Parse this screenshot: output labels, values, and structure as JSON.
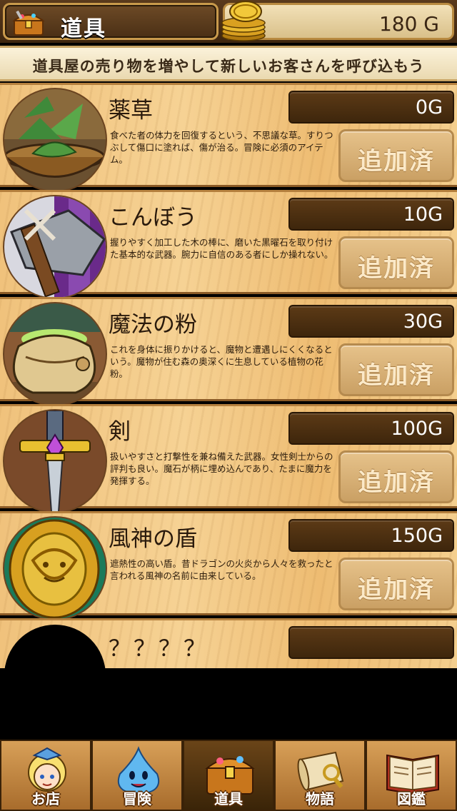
{
  "header": {
    "title": "道具",
    "title_icon": "treasure-chest-icon",
    "gold": "180 G",
    "gold_icon": "gold-coins-icon"
  },
  "banner": {
    "text": "道具屋の売り物を増やして新しいお客さんを呼び込もう"
  },
  "items": [
    {
      "name": "薬草",
      "price": "0G",
      "description": "食べた者の体力を回復するという、不思議な草。すりつぶして傷口に塗れば、傷が治る。冒険に必須のアイテム。",
      "button": "追加済",
      "icon": "herb-bowl-icon"
    },
    {
      "name": "こんぼう",
      "price": "10G",
      "description": "握りやすく加工した木の棒に、磨いた黒曜石を取り付けた基本的な武器。腕力に自信のある者にしか操れない。",
      "button": "追加済",
      "icon": "club-axe-icon"
    },
    {
      "name": "魔法の粉",
      "price": "30G",
      "description": "これを身体に振りかけると、魔物と遭遇しにくくなるという。魔物が住む森の奥深くに生息している植物の花粉。",
      "button": "追加済",
      "icon": "powder-sack-icon"
    },
    {
      "name": "剣",
      "price": "100G",
      "description": "扱いやすさと打撃性を兼ね備えた武器。女性剣士からの評判も良い。魔石が柄に埋め込んであり、たまに魔力を発揮する。",
      "button": "追加済",
      "icon": "sword-icon"
    },
    {
      "name": "風神の盾",
      "price": "150G",
      "description": "遮熱性の高い盾。昔ドラゴンの火炎から人々を救ったと言われる風神の名前に由来している。",
      "button": "追加済",
      "icon": "wind-shield-icon"
    },
    {
      "name": "？？？？",
      "price": "",
      "description": "",
      "button": "",
      "icon": "locked-silhouette-icon"
    }
  ],
  "nav": [
    {
      "label": "お店",
      "icon": "shopkeeper-girl-icon",
      "active": false
    },
    {
      "label": "冒険",
      "icon": "blue-slime-icon",
      "active": false
    },
    {
      "label": "道具",
      "icon": "treasure-chest-icon",
      "active": true
    },
    {
      "label": "物語",
      "icon": "scroll-icon",
      "active": false
    },
    {
      "label": "図鑑",
      "icon": "open-book-icon",
      "active": false
    }
  ],
  "colors": {
    "wood_light": "#f6d294",
    "wood_dark": "#8a5a26",
    "price_box": "#4a2f12",
    "button_face": "#dcb57c",
    "text_dark": "#2a1a0c"
  }
}
